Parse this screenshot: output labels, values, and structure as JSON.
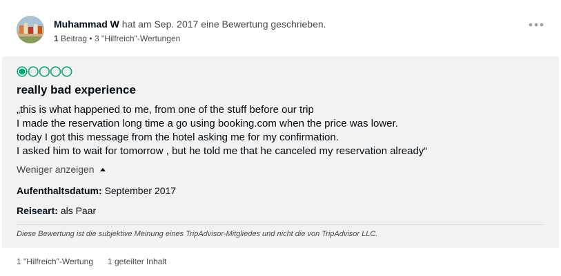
{
  "header": {
    "username": "Muhammad W",
    "action_text": "hat am Sep. 2017 eine Bewertung geschrieben.",
    "contributions_count": "1",
    "contributions_label": "Beitrag",
    "separator": "•",
    "helpful_votes": "3 \"Hilfreich\"-Wertungen"
  },
  "review": {
    "rating": 1,
    "rating_max": 5,
    "rating_color": "#00aa6c",
    "title": "really bad experience",
    "text_lines": [
      "„this is what happened to me, from one of the stuff before our trip",
      "I made the reservation long time a go using booking.com when the price was lower.",
      "today I got this message from the hotel asking me for my confirmation.",
      "I asked him to wait for tomorrow , but he told me that he canceled my reservation already“"
    ],
    "less_label": "Weniger anzeigen",
    "stay_label": "Aufenthaltsdatum:",
    "stay_value": "September 2017",
    "trip_label": "Reiseart:",
    "trip_value": "als Paar",
    "disclaimer": "Diese Bewertung ist die subjektive Meinung eines TripAdvisor-Mitgliedes und nicht die von TripAdvisor LLC."
  },
  "footer": {
    "helpful": "1 \"Hilfreich\"-Wertung",
    "shared": "1 geteilter Inhalt"
  },
  "icons": {
    "more": "more-horizontal-icon",
    "caret": "caret-up-icon"
  }
}
